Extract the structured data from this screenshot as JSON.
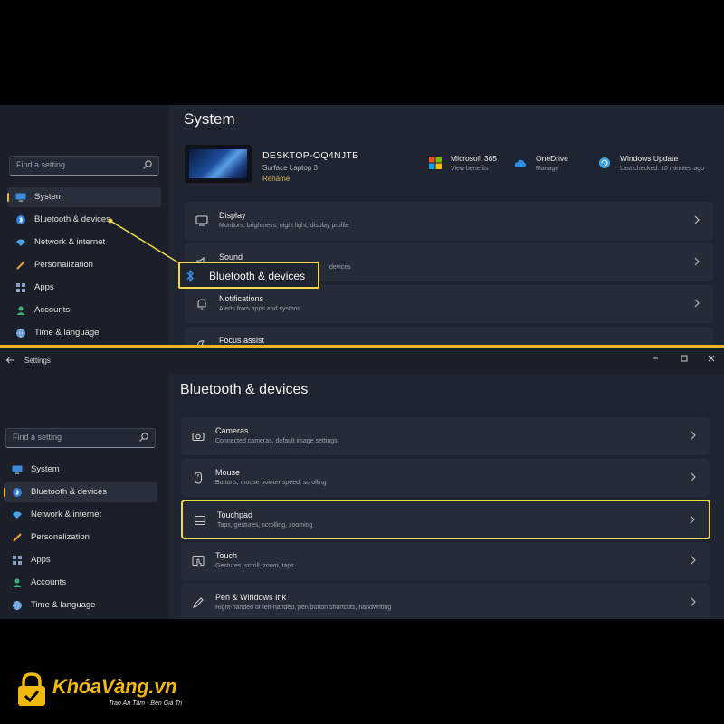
{
  "top": {
    "page_title": "System",
    "search_placeholder": "Find a setting",
    "nav": [
      {
        "label": "System",
        "icon": "monitor-icon",
        "selected": true
      },
      {
        "label": "Bluetooth & devices",
        "icon": "bluetooth-icon"
      },
      {
        "label": "Network & internet",
        "icon": "wifi-icon"
      },
      {
        "label": "Personalization",
        "icon": "brush-icon"
      },
      {
        "label": "Apps",
        "icon": "apps-icon"
      },
      {
        "label": "Accounts",
        "icon": "person-icon"
      },
      {
        "label": "Time & language",
        "icon": "globe-icon"
      }
    ],
    "device": {
      "name": "DESKTOP-OQ4NJTB",
      "model": "Surface Laptop 3",
      "rename": "Rename"
    },
    "quick": [
      {
        "title": "Microsoft 365",
        "sub": "View benefits",
        "icon": "microsoft-logo-icon"
      },
      {
        "title": "OneDrive",
        "sub": "Manage",
        "icon": "cloud-icon"
      },
      {
        "title": "Windows Update",
        "sub": "Last checked: 10 minutes ago",
        "icon": "update-icon"
      }
    ],
    "cards": [
      {
        "title": "Display",
        "sub": "Monitors, brightness, night light, display profile",
        "icon": "display-icon"
      },
      {
        "title": "Sound",
        "sub": "devices",
        "icon": "speaker-icon"
      },
      {
        "title": "Notifications",
        "sub": "Alerts from apps and system",
        "icon": "bell-icon"
      },
      {
        "title": "Focus assist",
        "sub": "",
        "icon": "moon-icon"
      }
    ],
    "callout_label": "Bluetooth & devices"
  },
  "bottom": {
    "window_title": "Settings",
    "page_title": "Bluetooth & devices",
    "search_placeholder": "Find a setting",
    "nav": [
      {
        "label": "System",
        "icon": "monitor-icon"
      },
      {
        "label": "Bluetooth & devices",
        "icon": "bluetooth-icon",
        "selected": true
      },
      {
        "label": "Network & internet",
        "icon": "wifi-icon"
      },
      {
        "label": "Personalization",
        "icon": "brush-icon"
      },
      {
        "label": "Apps",
        "icon": "apps-icon"
      },
      {
        "label": "Accounts",
        "icon": "person-icon"
      },
      {
        "label": "Time & language",
        "icon": "globe-icon"
      }
    ],
    "cards": [
      {
        "title": "Cameras",
        "sub": "Connected cameras, default image settings",
        "icon": "camera-icon"
      },
      {
        "title": "Mouse",
        "sub": "Buttons, mouse pointer speed, scrolling",
        "icon": "mouse-icon"
      },
      {
        "title": "Touchpad",
        "sub": "Taps, gestures, scrolling, zooming",
        "icon": "touchpad-icon",
        "highlighted": true
      },
      {
        "title": "Touch",
        "sub": "Gestures, scroll, zoom, taps",
        "icon": "touch-icon"
      },
      {
        "title": "Pen & Windows Ink",
        "sub": "Right-handed or left-handed, pen button shortcuts, handwriting",
        "icon": "pen-icon"
      }
    ]
  },
  "brand": {
    "name": "KhóaVàng.vn",
    "tagline": "Trao An Tâm - Bền Giá Trị",
    "color": "#f0b90b"
  },
  "colors": {
    "accent": "#f2b51e",
    "highlight": "#f2d94a",
    "panel_bg": "#1e2430",
    "card_bg": "#262c37"
  }
}
